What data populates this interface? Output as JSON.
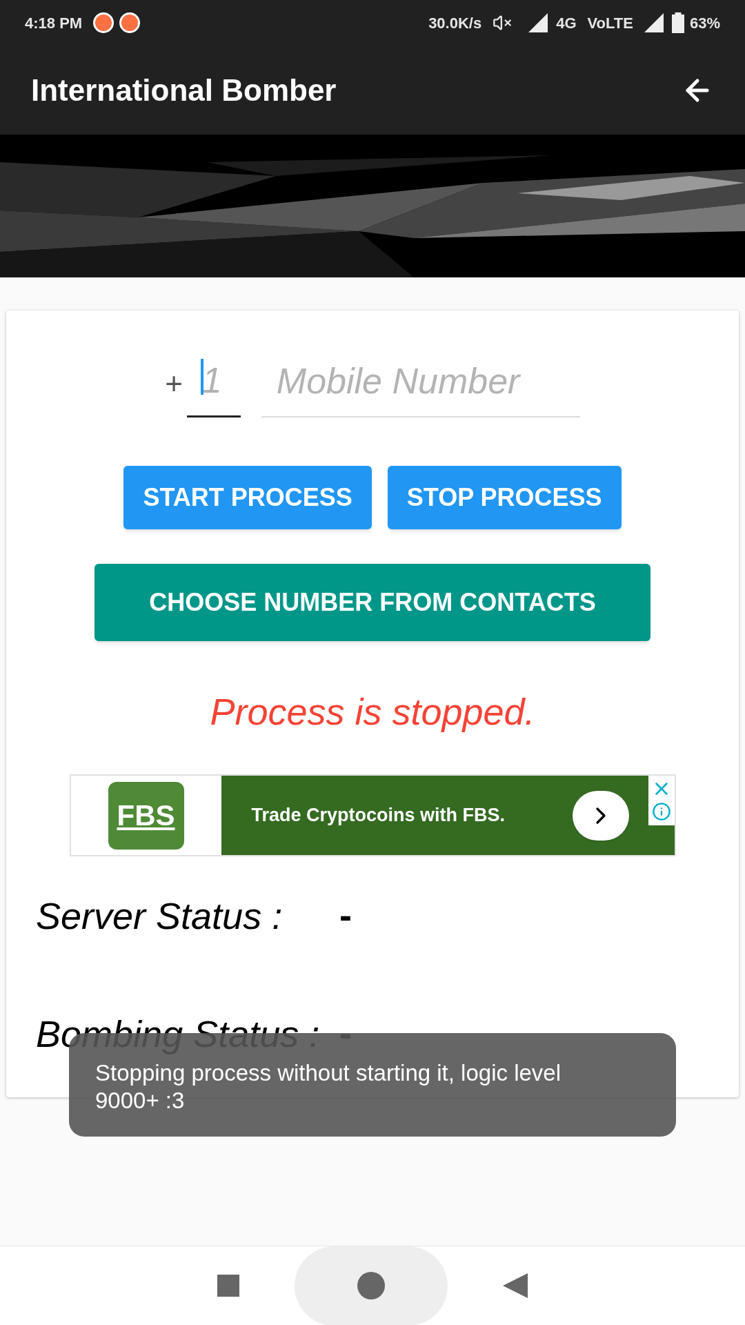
{
  "status_bar": {
    "time": "4:18 PM",
    "speed": "30.0K/s",
    "network": "4G",
    "volte": "VoLTE",
    "battery": "63%"
  },
  "app_bar": {
    "title": "International Bomber"
  },
  "phone_form": {
    "prefix": "+",
    "country_code": {
      "placeholder": "1",
      "focused": true
    },
    "number": {
      "placeholder": "Mobile Number",
      "focused": false
    }
  },
  "buttons": [
    {
      "label": "START PROCESS",
      "kind": "primary"
    },
    {
      "label": "STOP PROCESS",
      "kind": "primary"
    },
    {
      "label": "CHOOSE NUMBER FROM CONTACTS",
      "kind": "accent"
    }
  ],
  "process_message": "Process is stopped.",
  "ad": {
    "logo": "FBS",
    "text": "Trade Cryptocoins with FBS."
  },
  "statuses": [
    {
      "label": "Server Status :",
      "value": "-"
    },
    {
      "label": "Bombing Status :",
      "value": "-"
    }
  ],
  "toast": "Stopping process without starting it, logic level 9000+ :3"
}
